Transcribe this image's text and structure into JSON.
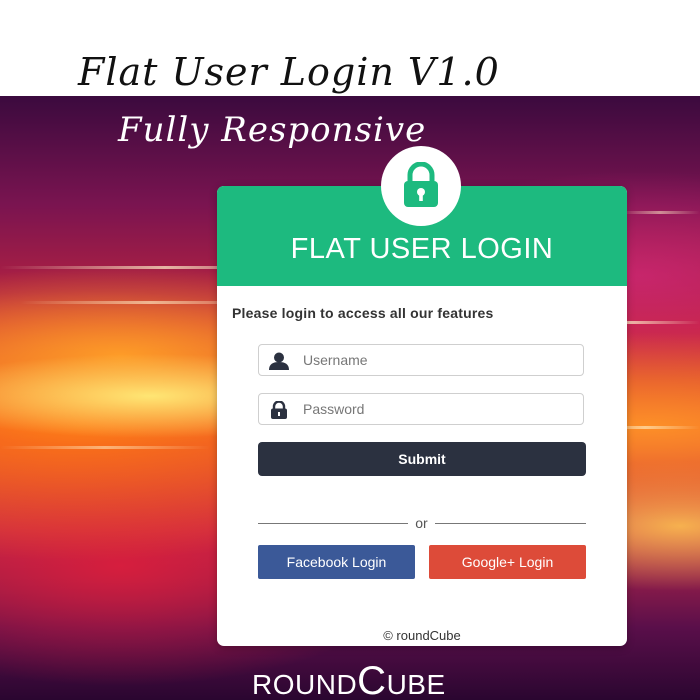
{
  "page": {
    "title_line1": "Flat User Login V1.0",
    "title_line2": "Fully Responsive"
  },
  "login_card": {
    "header_title": "FLAT USER LOGIN",
    "header_color": "#1dba7f",
    "lock_icon": "lock-icon",
    "intro_text": "Please login to access all our features",
    "username": {
      "placeholder": "Username",
      "value": "",
      "icon": "user-icon"
    },
    "password": {
      "placeholder": "Password",
      "value": "",
      "icon": "lock-icon"
    },
    "submit_label": "Submit",
    "submit_color": "#2b3140",
    "divider_text": "or",
    "facebook_label": "Facebook Login",
    "facebook_color": "#3b5998",
    "google_label": "Google+ Login",
    "google_color": "#dd4b39",
    "footer_text": "© roundCube"
  },
  "brand": {
    "prefix": "ROUND",
    "big_letter": "C",
    "suffix": "UBE"
  }
}
